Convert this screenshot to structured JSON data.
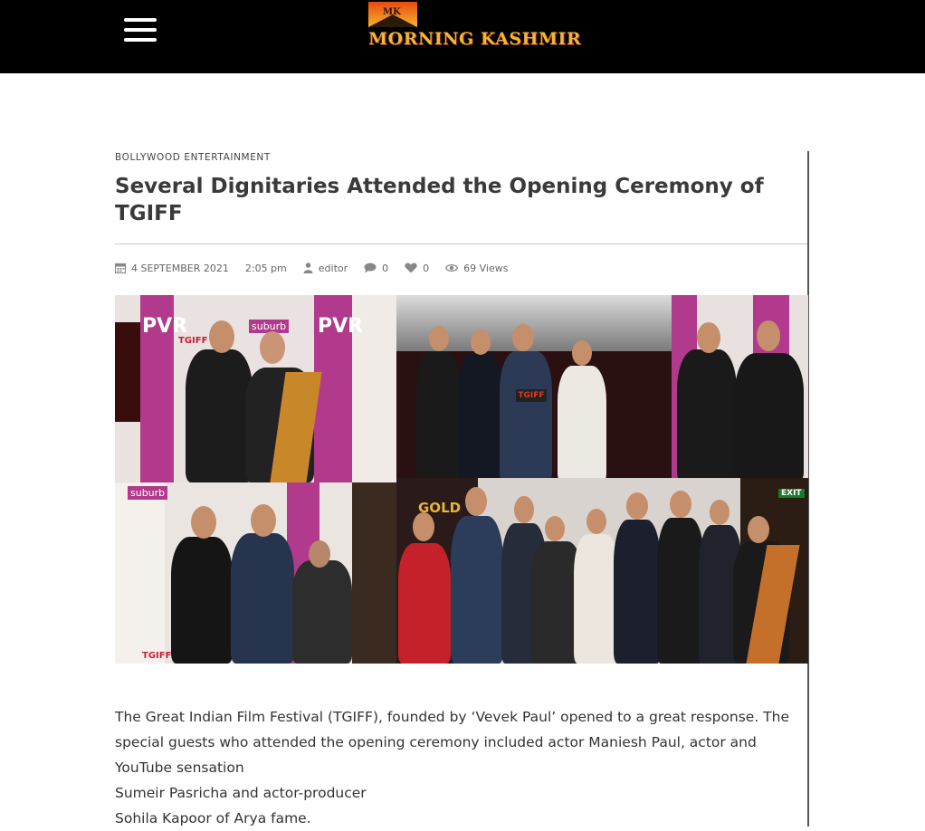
{
  "header": {
    "logo": {
      "mark_text": "MK",
      "brand_text": "MORNING KASHMIR"
    }
  },
  "article": {
    "category": "BOLLYWOOD ENTERTAINMENT",
    "title": "Several Dignitaries Attended the Opening Ceremony of TGIFF",
    "meta": {
      "date": "4 SEPTEMBER 2021",
      "time": "2:05 pm",
      "author": "editor",
      "comments": "0",
      "likes": "0",
      "views": "69 Views"
    },
    "image": {
      "backdrop_words": [
        "PVR",
        "suburb",
        "TGIFF",
        "PVR",
        "suburb",
        "TGIFF",
        "GOLD",
        "EXIT"
      ]
    },
    "body_lines": [
      "The Great Indian Film Festival (TGIFF), founded by ‘Vevek Paul’ opened to a great response. The",
      "special guests who attended the opening ceremony included actor Maniesh Paul, actor and",
      "YouTube sensation",
      "Sumeir Pasricha and actor-producer",
      "Sohila Kapoor of Arya fame."
    ]
  },
  "colors": {
    "topbar": "#000000",
    "logo_gold": "#f3b43a",
    "title": "#3a3a3a",
    "body": "#333333",
    "meta": "#666666",
    "backdrop_magenta": "#b23a8c"
  }
}
